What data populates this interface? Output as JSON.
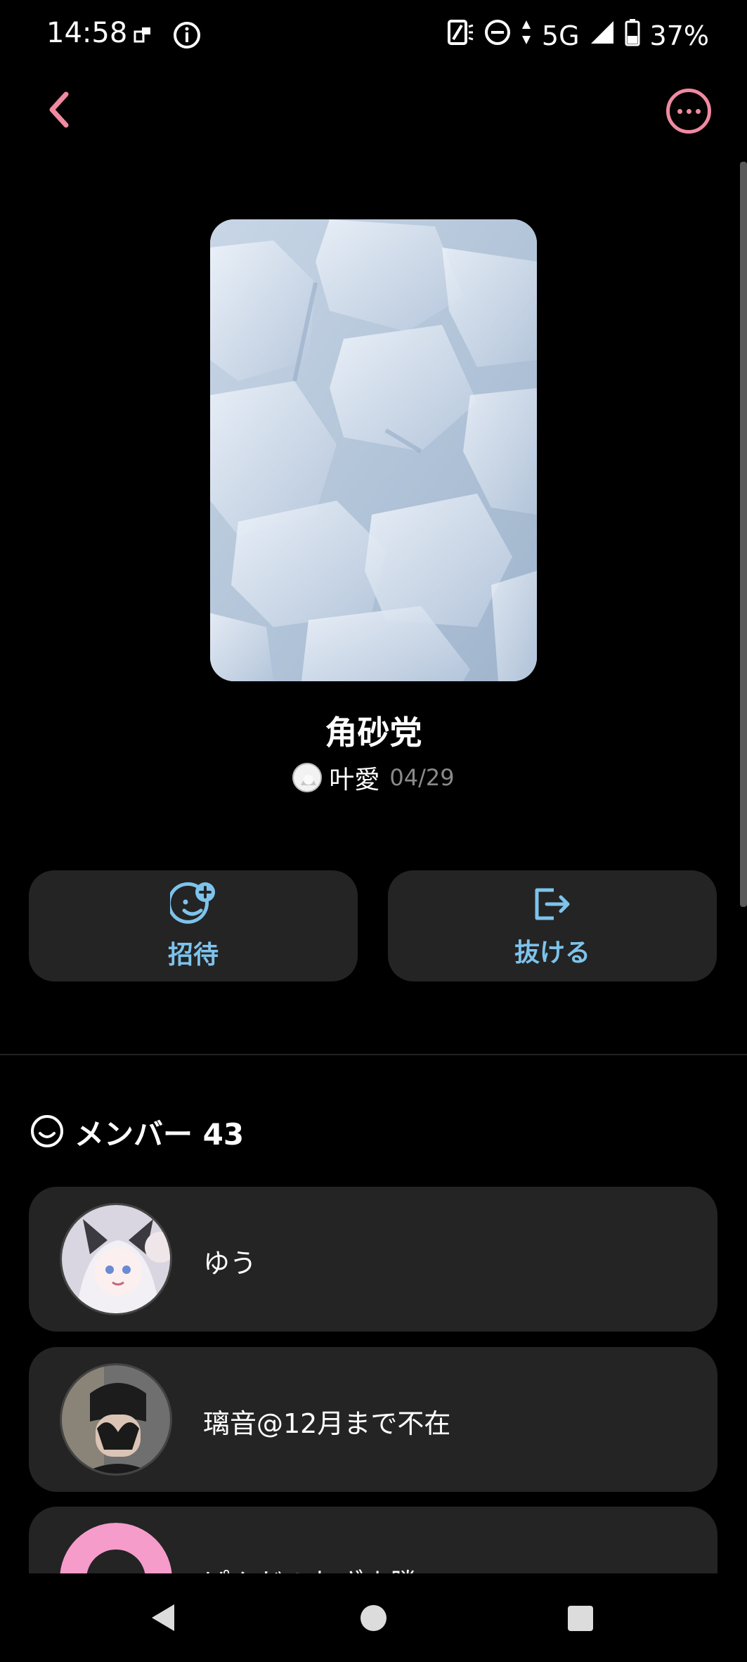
{
  "status_bar": {
    "time": "14:58",
    "network": "5G",
    "battery": "37%"
  },
  "group": {
    "title": "角砂党",
    "creator_name": "叶愛",
    "created_date": "04/29"
  },
  "actions": {
    "invite_label": "招待",
    "leave_label": "抜ける"
  },
  "members": {
    "label": "メンバー 43",
    "items": [
      {
        "name": "ゆう"
      },
      {
        "name": "璃音@12月まで不在"
      },
      {
        "name": "ぱんだ@おざま勝"
      }
    ]
  },
  "colors": {
    "accent_pink": "#f08aa0",
    "accent_blue": "#7dc3ec",
    "card_bg": "#242424"
  }
}
